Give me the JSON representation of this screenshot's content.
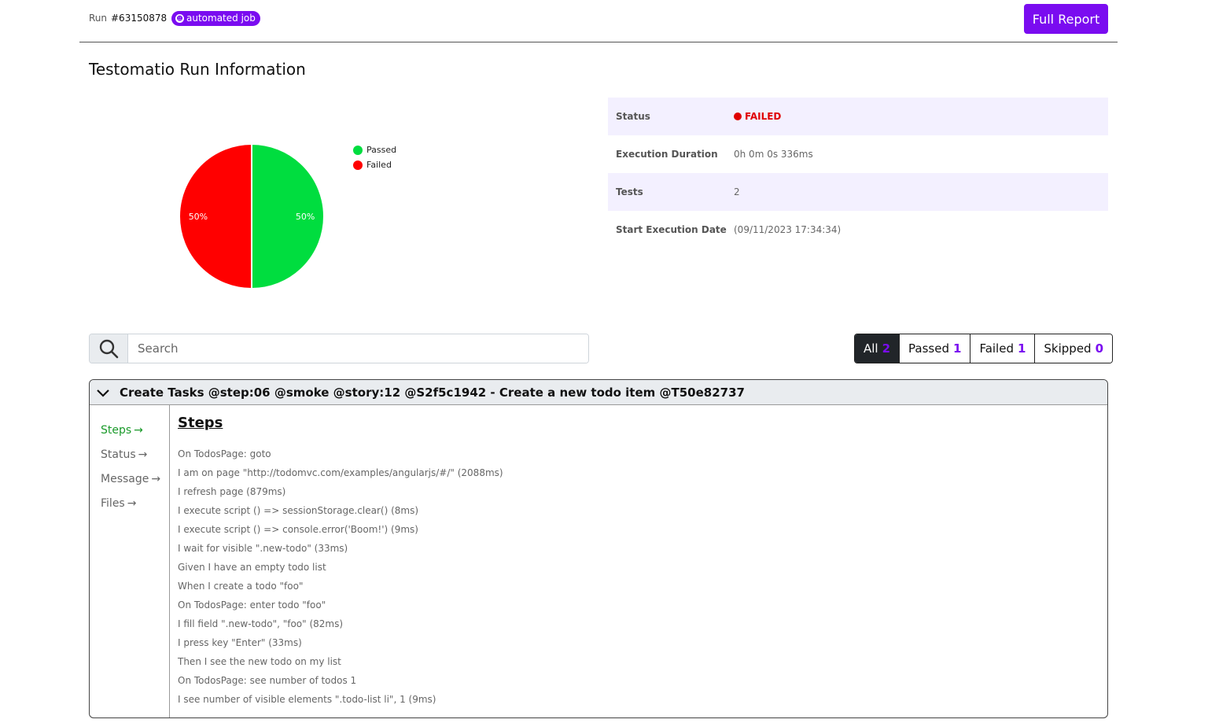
{
  "header": {
    "run_label": "Run",
    "run_id": "#63150878",
    "badge_label": "automated job",
    "full_report_label": "Full Report"
  },
  "page_title": "Testomatio Run Information",
  "chart_data": {
    "type": "pie",
    "categories": [
      "Passed",
      "Failed"
    ],
    "values": [
      50,
      50
    ],
    "colors": [
      "#00dd3f",
      "#ff0000"
    ],
    "data_labels": [
      "50%",
      "50%"
    ],
    "legend_placement": "top-right"
  },
  "info": {
    "status_key": "Status",
    "status_value": "FAILED",
    "duration_key": "Execution Duration",
    "duration_value": "0h 0m 0s 336ms",
    "tests_key": "Tests",
    "tests_value": "2",
    "start_key": "Start Execution Date",
    "start_value": "(09/11/2023 17:34:34)"
  },
  "search": {
    "placeholder": "Search"
  },
  "filters": [
    {
      "label": "All",
      "count": "2"
    },
    {
      "label": "Passed",
      "count": "1"
    },
    {
      "label": "Failed",
      "count": "1"
    },
    {
      "label": "Skipped",
      "count": "0"
    }
  ],
  "test": {
    "title": "Create Tasks @step:06 @smoke @story:12 @S2f5c1942 - Create a new todo item @T50e82737",
    "nav": [
      "Steps",
      "Status",
      "Message",
      "Files"
    ],
    "steps_title": "Steps",
    "steps": [
      "On TodosPage: goto",
      "I am on page \"http://todomvc.com/examples/angularjs/#/\" (2088ms)",
      "I refresh page (879ms)",
      "I execute script () => sessionStorage.clear() (8ms)",
      "I execute script () => console.error('Boom!') (9ms)",
      "I wait for visible \".new-todo\" (33ms)",
      "Given I have an empty todo list",
      "When I create a todo \"foo\"",
      "On TodosPage: enter todo \"foo\"",
      "I fill field \".new-todo\", \"foo\" (82ms)",
      "I press key \"Enter\" (33ms)",
      "Then I see the new todo on my list",
      "On TodosPage: see number of todos 1",
      "I see number of visible elements \".todo-list li\", 1 (9ms)"
    ]
  }
}
